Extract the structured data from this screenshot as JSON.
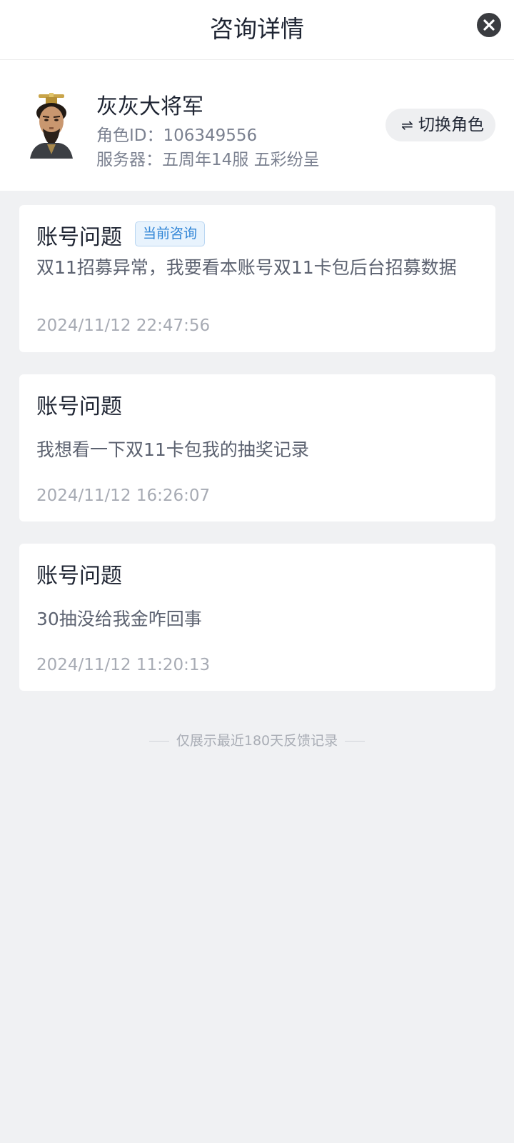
{
  "header": {
    "title": "咨询详情"
  },
  "profile": {
    "role_name": "灰灰大将军",
    "role_id": "角色ID：106349556",
    "server": "服务器：五周年14服 五彩纷呈",
    "switch_icon": "⇌",
    "switch_label": "切换角色"
  },
  "consultations": [
    {
      "category": "账号问题",
      "badge": "当前咨询",
      "content": "双11招募异常，我要看本账号双11卡包后台招募数据",
      "time": "2024/11/12 22:47:56"
    },
    {
      "category": "账号问题",
      "content": "我想看一下双11卡包我的抽奖记录",
      "time": "2024/11/12 16:26:07"
    },
    {
      "category": "账号问题",
      "content": "30抽没给我金咋回事",
      "time": "2024/11/12 11:20:13"
    }
  ],
  "footer": {
    "note": "仅展示最近180天反馈记录"
  }
}
